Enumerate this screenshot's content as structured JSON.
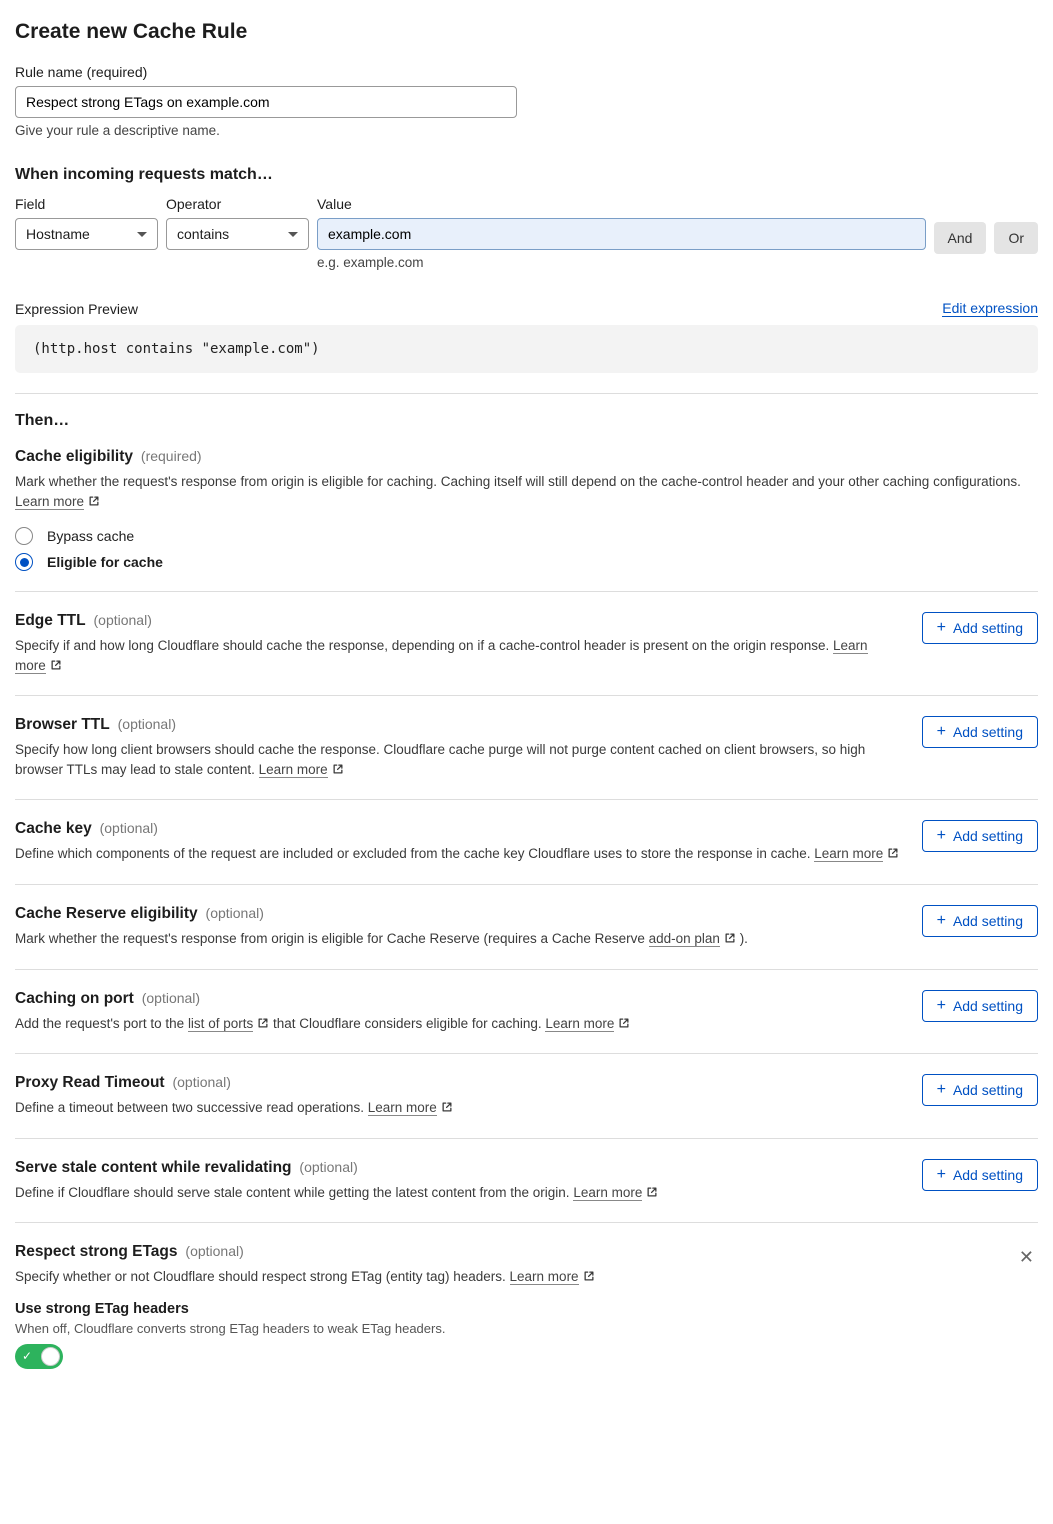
{
  "page_title": "Create new Cache Rule",
  "rule_name": {
    "label": "Rule name (required)",
    "value": "Respect strong ETags on example.com",
    "helper": "Give your rule a descriptive name."
  },
  "when": {
    "title": "When incoming requests match…",
    "field_label": "Field",
    "field_value": "Hostname",
    "operator_label": "Operator",
    "operator_value": "contains",
    "value_label": "Value",
    "value_value": "example.com",
    "value_helper": "e.g. example.com",
    "and": "And",
    "or": "Or"
  },
  "expression": {
    "label": "Expression Preview",
    "edit": "Edit expression",
    "code": "(http.host contains \"example.com\")"
  },
  "then_title": "Then…",
  "eligibility": {
    "title": "Cache eligibility",
    "tag": "(required)",
    "desc": "Mark whether the request's response from origin is eligible for caching. Caching itself will still depend on the cache-control header and your other caching configurations. ",
    "learn": "Learn more",
    "bypass": "Bypass cache",
    "eligible": "Eligible for cache"
  },
  "add_setting": "Add setting",
  "edge_ttl": {
    "title": "Edge TTL",
    "tag": "(optional)",
    "desc": "Specify if and how long Cloudflare should cache the response, depending on if a cache-control header is present on the origin response. ",
    "learn": "Learn more"
  },
  "browser_ttl": {
    "title": "Browser TTL",
    "tag": "(optional)",
    "desc": "Specify how long client browsers should cache the response. Cloudflare cache purge will not purge content cached on client browsers, so high browser TTLs may lead to stale content. ",
    "learn": "Learn more"
  },
  "cache_key": {
    "title": "Cache key",
    "tag": "(optional)",
    "desc": "Define which components of the request are included or excluded from the cache key Cloudflare uses to store the response in cache. ",
    "learn": "Learn more"
  },
  "cache_reserve": {
    "title": "Cache Reserve eligibility",
    "tag": "(optional)",
    "desc_pre": "Mark whether the request's response from origin is eligible for Cache Reserve (requires a Cache Reserve ",
    "link": "add-on plan",
    "desc_post": " )."
  },
  "caching_port": {
    "title": "Caching on port",
    "tag": "(optional)",
    "desc_pre": "Add the request's port to the ",
    "link": "list of ports",
    "desc_mid": " that Cloudflare considers eligible for caching. ",
    "learn": "Learn more"
  },
  "proxy_timeout": {
    "title": "Proxy Read Timeout",
    "tag": "(optional)",
    "desc": "Define a timeout between two successive read operations. ",
    "learn": "Learn more"
  },
  "serve_stale": {
    "title": "Serve stale content while revalidating",
    "tag": "(optional)",
    "desc": "Define if Cloudflare should serve stale content while getting the latest content from the origin. ",
    "learn": "Learn more"
  },
  "respect_etags": {
    "title": "Respect strong ETags",
    "tag": "(optional)",
    "desc": "Specify whether or not Cloudflare should respect strong ETag (entity tag) headers. ",
    "learn": "Learn more",
    "toggle_title": "Use strong ETag headers",
    "toggle_desc": "When off, Cloudflare converts strong ETag headers to weak ETag headers."
  }
}
